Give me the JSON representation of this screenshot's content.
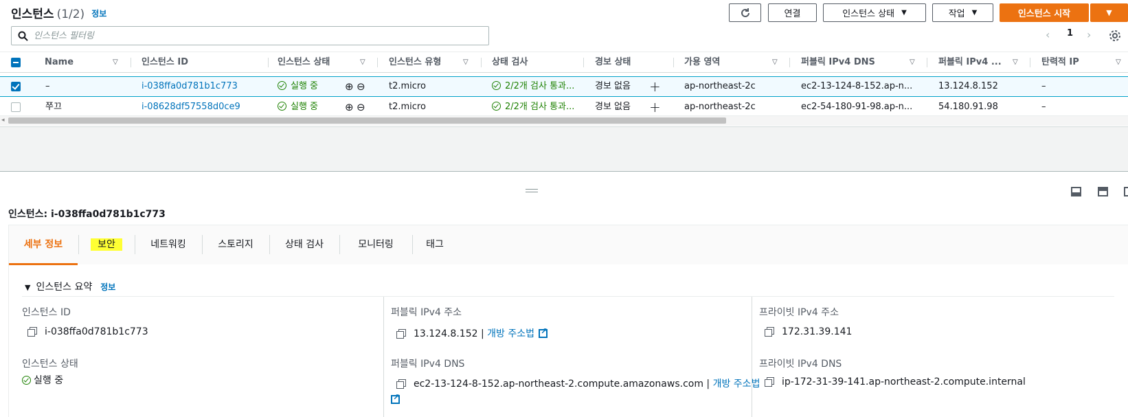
{
  "header": {
    "title": "인스턴스",
    "count": "(1/2)",
    "info": "정보"
  },
  "toolbar": {
    "connect": "연결",
    "instance_state": "인스턴스 상태",
    "actions": "작업",
    "launch": "인스턴스 시작"
  },
  "search": {
    "placeholder": "인스턴스 필터링"
  },
  "pagination": {
    "page": "1"
  },
  "table": {
    "columns": [
      "Name",
      "인스턴스 ID",
      "인스턴스 상태",
      "인스턴스 유형",
      "상태 검사",
      "경보 상태",
      "가용 영역",
      "퍼블릭 IPv4 DNS",
      "퍼블릭 IPv4 ...",
      "탄력적 IP"
    ],
    "rows": [
      {
        "name": "–",
        "id": "i-038ffa0d781b1c773",
        "state": "실행 중",
        "type": "t2.micro",
        "check": "2/2개 검사 통과...",
        "alarm": "경보 없음",
        "az": "ap-northeast-2c",
        "dns": "ec2-13-124-8-152.ap-n...",
        "ip": "13.124.8.152",
        "eip": "–",
        "selected": true
      },
      {
        "name": "쭈끄",
        "id": "i-08628df57558d0ce9",
        "state": "실행 중",
        "type": "t2.micro",
        "check": "2/2개 검사 통과...",
        "alarm": "경보 없음",
        "az": "ap-northeast-2c",
        "dns": "ec2-54-180-91-98.ap-n...",
        "ip": "54.180.91.98",
        "eip": "–",
        "selected": false
      }
    ]
  },
  "detail": {
    "title": "인스턴스: i-038ffa0d781b1c773",
    "tabs": [
      "세부 정보",
      "보안",
      "네트워킹",
      "스토리지",
      "상태 검사",
      "모니터링",
      "태그"
    ],
    "section_title": "인스턴스 요약",
    "section_info": "정보",
    "fields": {
      "instance_id_label": "인스턴스 ID",
      "instance_id": "i-038ffa0d781b1c773",
      "public_ip_label": "퍼블릭 IPv4 주소",
      "public_ip": "13.124.8.152 |",
      "public_ip_link": "개방 주소법",
      "private_ip_label": "프라이빗 IPv4 주소",
      "private_ip": "172.31.39.141",
      "state_label": "인스턴스 상태",
      "state": "실행 중",
      "public_dns_label": "퍼블릭 IPv4 DNS",
      "public_dns": "ec2-13-124-8-152.ap-northeast-2.compute.amazonaws.com |",
      "public_dns_link": "개방 주소법",
      "private_dns_label": "프라이빗 IPv4 DNS",
      "private_dns": "ip-172-31-39-141.ap-northeast-2.compute.internal"
    }
  },
  "colors": {
    "accent": "#ec7211",
    "link": "#0073bb",
    "success": "#1d8102",
    "highlight": "#ffff33"
  }
}
